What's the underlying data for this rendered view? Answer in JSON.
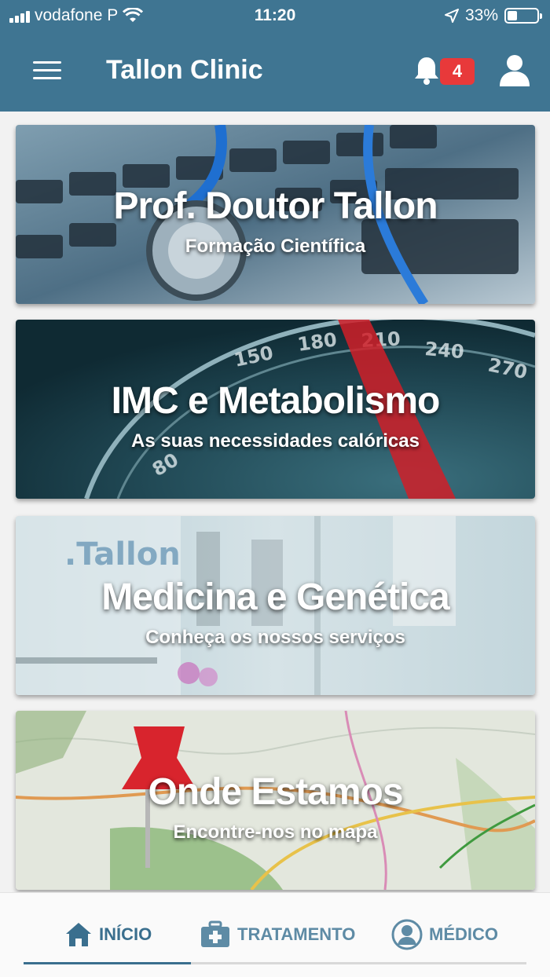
{
  "status_bar": {
    "carrier": "vodafone P",
    "time": "11:20",
    "battery": "33%",
    "battery_level": 0.33
  },
  "header": {
    "title": "Tallon Clinic",
    "notification_count": "4",
    "menu_icon": "hamburger-menu-icon",
    "bell_icon": "bell-icon",
    "profile_icon": "user-profile-icon"
  },
  "cards": [
    {
      "title": "Prof. Doutor Tallon",
      "subtitle": "Formação Científica"
    },
    {
      "title": "IMC e Metabolismo",
      "subtitle": "As suas necessidades calóricas"
    },
    {
      "title": "Medicina e Genética",
      "subtitle": "Conheça os nossos serviços"
    },
    {
      "title": "Onde Estamos",
      "subtitle": "Encontre-nos no mapa"
    }
  ],
  "bottom_nav": {
    "items": [
      {
        "label": "INÍCIO",
        "icon": "home-icon",
        "active": true
      },
      {
        "label": "TRATAMENTO",
        "icon": "medical-kit-icon",
        "active": false
      },
      {
        "label": "MÉDICO",
        "icon": "doctor-avatar-icon",
        "active": false
      }
    ]
  },
  "colors": {
    "header": "#3f7592",
    "badge": "#e8393a",
    "nav_active": "#3a6f8e",
    "nav_inactive": "#5e8ba5"
  }
}
